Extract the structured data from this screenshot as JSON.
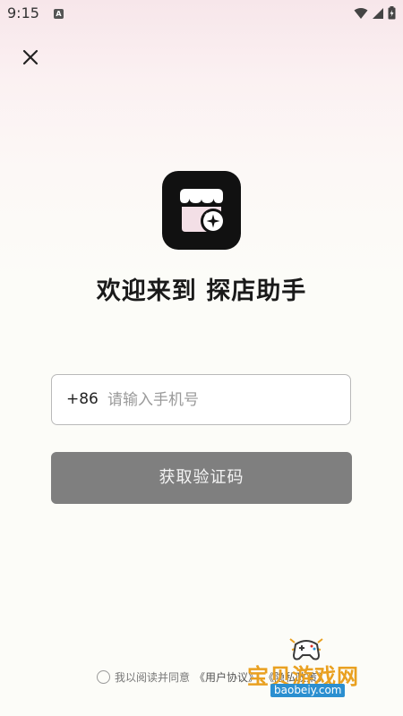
{
  "status_bar": {
    "time": "9:15",
    "notification_glyph": "A",
    "icons": [
      "wifi-icon",
      "signal-icon",
      "battery-icon"
    ]
  },
  "header": {
    "close_icon": "close-icon"
  },
  "hero": {
    "logo_icon": "shop-sparkle-icon",
    "title": "欢迎来到 探店助手"
  },
  "login": {
    "country_code": "+86",
    "phone_value": "",
    "phone_placeholder": "请输入手机号",
    "get_code_label": "获取验证码",
    "button_color": "#7f7f7f"
  },
  "agreement": {
    "checked": false,
    "prefix": "我以阅读并同意",
    "user_agreement": "《用户协议》",
    "privacy_policy": "《隐私政策》"
  },
  "watermark": {
    "title": "宝贝游戏网",
    "url": "baobeiy.com"
  },
  "colors": {
    "accent_watermark": "#e9a020",
    "watermark_url_bg": "#2b8fd0"
  }
}
